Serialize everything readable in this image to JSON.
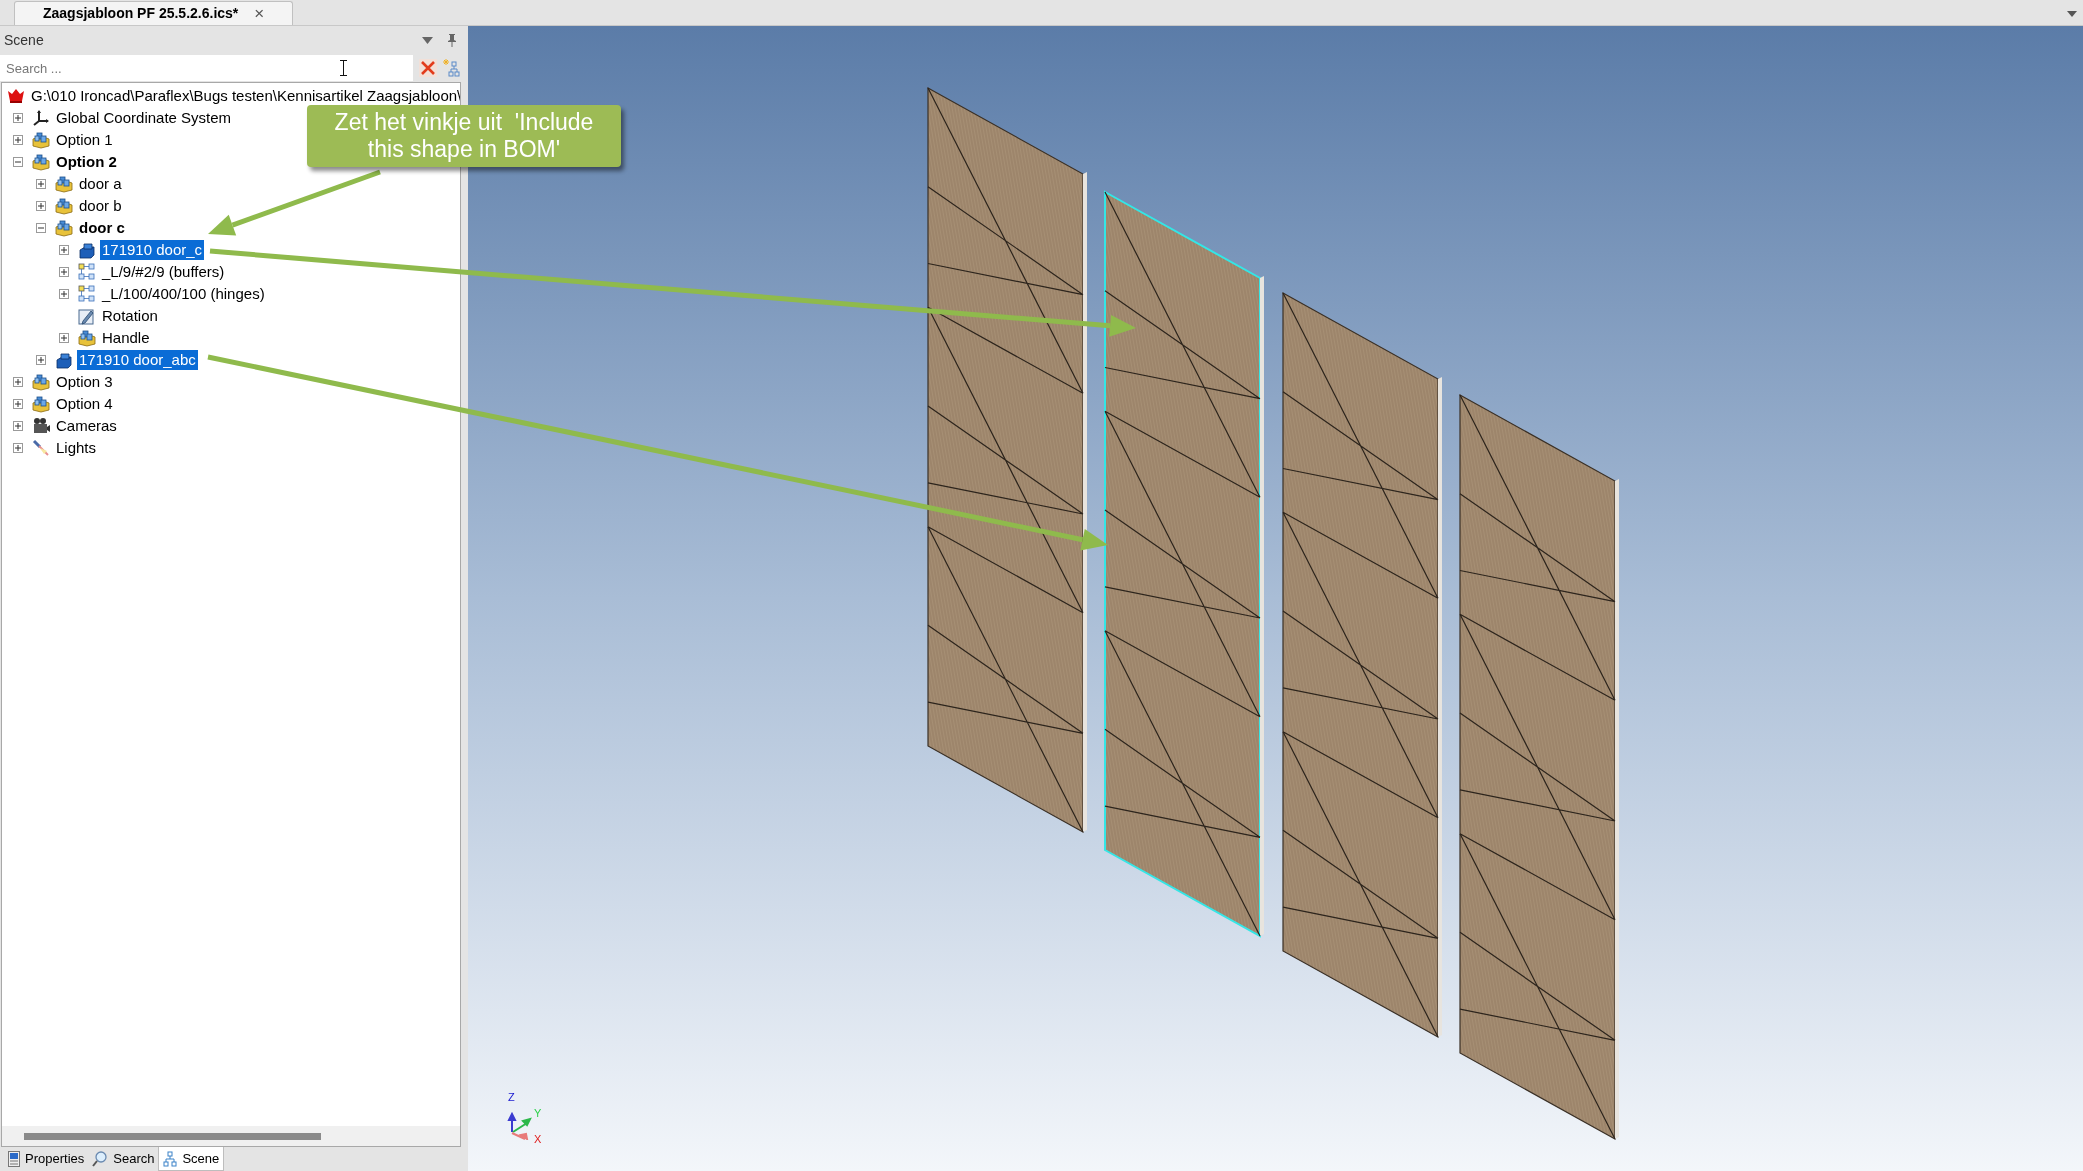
{
  "document_tab": {
    "title": "Zaagsjabloon PF 25.5.2.6.ics*",
    "close": "×"
  },
  "panel": {
    "title": "Scene",
    "search": {
      "placeholder": "Search ..."
    }
  },
  "tree": [
    {
      "label": "G:\\010 Ironcad\\Paraflex\\Bugs testen\\Kennisartikel Zaagsjabloon\\",
      "kind": "root",
      "selected": false,
      "active": false,
      "children": [
        {
          "label": "Global Coordinate System",
          "kind": "coordinate",
          "expanded": false,
          "selected": false,
          "active": false
        },
        {
          "label": "Option 1",
          "kind": "assembly",
          "expanded": false,
          "selected": false,
          "active": false
        },
        {
          "label": "Option 2",
          "kind": "assembly",
          "expanded": true,
          "selected": false,
          "active": true,
          "children": [
            {
              "label": "door a",
              "kind": "assembly",
              "expanded": false,
              "selected": false,
              "active": false
            },
            {
              "label": "door b",
              "kind": "assembly",
              "expanded": false,
              "selected": false,
              "active": false
            },
            {
              "label": "door c",
              "kind": "assembly",
              "expanded": true,
              "selected": false,
              "active": true,
              "children": [
                {
                  "label": "171910 door_c",
                  "kind": "part",
                  "expanded": false,
                  "selected": true,
                  "active": false
                },
                {
                  "label": "_L/9/#2/9 (buffers)",
                  "kind": "pattern",
                  "expanded": false,
                  "selected": false,
                  "active": false
                },
                {
                  "label": "_L/100/400/100 (hinges)",
                  "kind": "pattern",
                  "expanded": false,
                  "selected": false,
                  "active": false
                },
                {
                  "label": "Rotation",
                  "kind": "rotation",
                  "selected": false,
                  "active": false
                },
                {
                  "label": "Handle",
                  "kind": "assembly",
                  "expanded": false,
                  "selected": false,
                  "active": false
                }
              ]
            },
            {
              "label": "171910 door_abc",
              "kind": "part",
              "expanded": false,
              "selected": true,
              "active": false
            }
          ]
        },
        {
          "label": "Option 3",
          "kind": "assembly",
          "expanded": false,
          "selected": false,
          "active": false
        },
        {
          "label": "Option 4",
          "kind": "assembly",
          "expanded": false,
          "selected": false,
          "active": false
        },
        {
          "label": "Cameras",
          "kind": "camera",
          "expanded": false,
          "selected": false,
          "active": false
        },
        {
          "label": "Lights",
          "kind": "light",
          "expanded": false,
          "selected": false,
          "active": false
        }
      ]
    }
  ],
  "bottom_tabs": [
    {
      "label": "Properties",
      "kind": "properties",
      "selected": false
    },
    {
      "label": "Search",
      "kind": "search",
      "selected": false
    },
    {
      "label": "Scene",
      "kind": "scene",
      "selected": true
    }
  ],
  "callout": {
    "text": "Zet het vinkje uit  'Include this shape in BOM'"
  },
  "axis_labels": [
    "Z",
    "Y",
    "X"
  ]
}
